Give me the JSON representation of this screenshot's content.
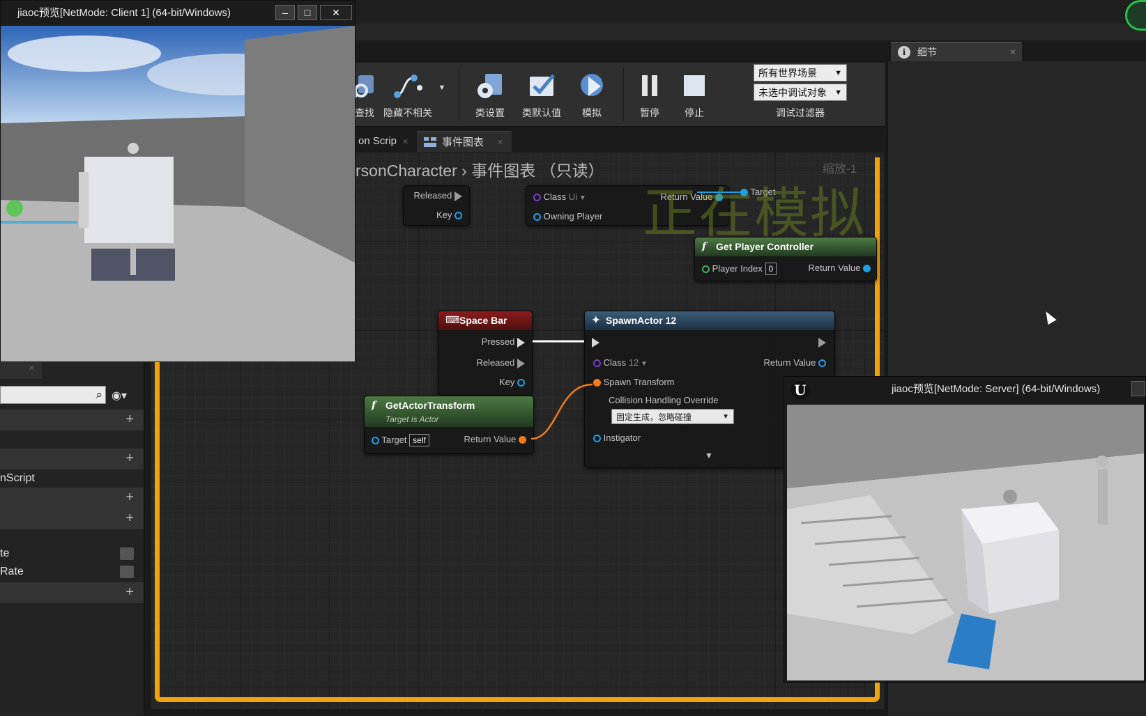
{
  "client_window": {
    "title": "jiaoc预览[NetMode: Client 1]  (64-bit/Windows)",
    "minimize": "–",
    "maximize": "□",
    "close": "✕"
  },
  "toolbar": {
    "find_label": "查找",
    "hide_unrelated_label": "隐藏不相关",
    "class_settings_label": "类设置",
    "class_defaults_label": "类默认值",
    "simulate_label": "模拟",
    "pause_label": "暂停",
    "stop_label": "停止",
    "world_dropdown": "所有世界场景",
    "debug_object_dropdown": "未选中调试对象",
    "debug_filter_label": "调试过滤器"
  },
  "details": {
    "tab_label": "细节",
    "info_icon": "i"
  },
  "graph_tabs": {
    "construction_script": "on Scrip",
    "event_graph": "事件图表"
  },
  "breadcrumb": {
    "path": "rsonCharacter",
    "separator": "›",
    "graph": "事件图表",
    "readonly": "（只读）"
  },
  "watermark": "正在模拟",
  "zoom_label": "缩放-1",
  "nodes": {
    "top_input": {
      "released": "Released",
      "key": "Key"
    },
    "create_widget": {
      "class_label": "Class",
      "class_value": "Ui",
      "return_value": "Return Value",
      "owning_player": "Owning Player",
      "target": "Target"
    },
    "get_player_controller": {
      "title": "Get Player Controller",
      "player_index": "Player Index",
      "player_index_value": "0",
      "return_value": "Return Value"
    },
    "space_bar": {
      "title": "Space Bar",
      "pressed": "Pressed",
      "released": "Released",
      "key": "Key"
    },
    "get_actor_transform": {
      "title": "GetActorTransform",
      "subtitle": "Target is Actor",
      "target": "Target",
      "self": "self",
      "return_value": "Return Value"
    },
    "spawn_actor": {
      "title": "SpawnActor 12",
      "class_label": "Class",
      "class_value": "12",
      "return_value": "Return Value",
      "spawn_transform": "Spawn Transform",
      "collision": "Collision Handling Override",
      "collision_value": "固定生成，忽略碰撞",
      "instigator": "Instigator"
    }
  },
  "left_panel": {
    "rows": [
      {
        "label": "",
        "type": "cat",
        "control": "+"
      },
      {
        "label": "",
        "type": "plain"
      },
      {
        "label": "",
        "type": "cat",
        "control": "+"
      },
      {
        "label": "nScript",
        "type": "plain"
      },
      {
        "label": "",
        "type": "cat",
        "control": "+"
      },
      {
        "label": "",
        "type": "cat",
        "control": "+"
      },
      {
        "label": "te",
        "type": "plain",
        "control": "check"
      },
      {
        "label": "Rate",
        "type": "plain",
        "control": "check"
      },
      {
        "label": "",
        "type": "cat",
        "control": "+"
      }
    ]
  },
  "server_window": {
    "title": "jiaoc预览[NetMode: Server]  (64-bit/Windows)",
    "logo": "U"
  },
  "colors": {
    "simulating_border": "#f2a20c",
    "exec_wire": "#ffffff",
    "transform_wire": "#f07a1c",
    "watermark": "#788c1e"
  }
}
